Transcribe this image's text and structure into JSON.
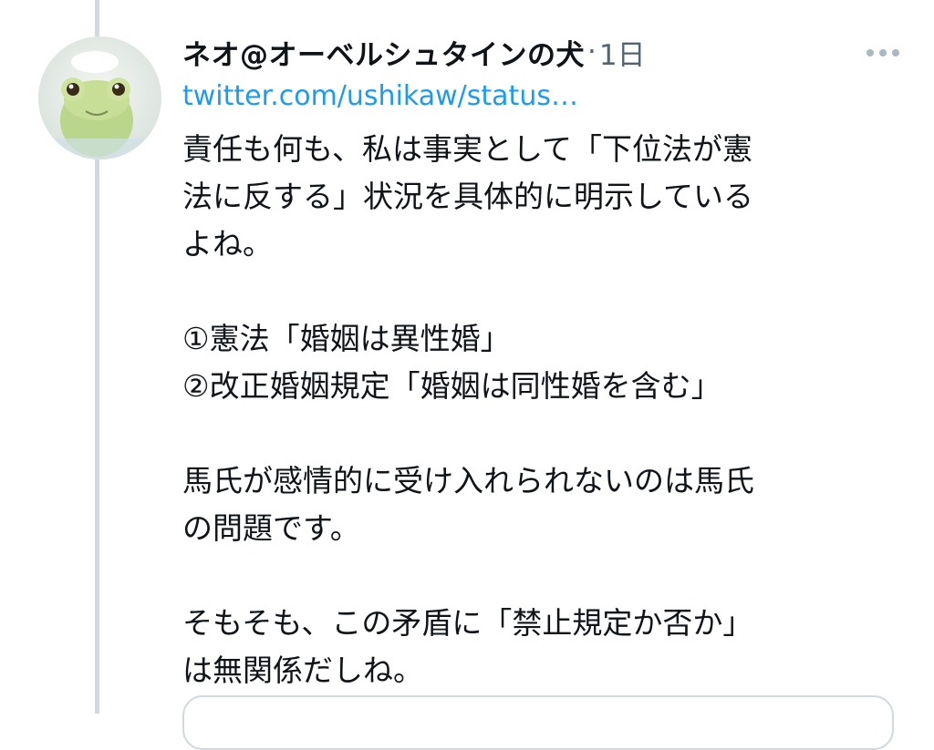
{
  "tweet": {
    "display_name": "ネオ@オーベルシュタインの犬",
    "separator": "·",
    "timestamp": "1日",
    "link_text": "twitter.com/ushikaw/status…",
    "body_lines": [
      "責任も何も、私は事実として「下位法が憲",
      "法に反する」状況を具体的に明示している",
      "よね。",
      "",
      "①憲法「婚姻は異性婚」",
      "②改正婚姻規定「婚姻は同性婚を含む」",
      "",
      "馬氏が感情的に受け入れられないのは馬氏",
      "の問題です。",
      "",
      "そもそも、この矛盾に「禁止規定か否か」",
      "は無関係だしね。"
    ]
  },
  "icons": {
    "avatar": "frog-avatar",
    "more": "more-horizontal-icon"
  },
  "colors": {
    "text": "#0f1419",
    "secondary": "#536471",
    "link": "#1d9bf0",
    "border": "#cfd9de"
  }
}
